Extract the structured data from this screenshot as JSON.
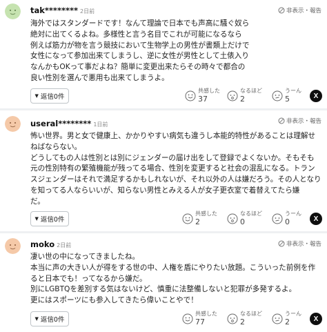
{
  "report_label": "非表示・報告",
  "comments": [
    {
      "username": "tak********",
      "date": "2日前",
      "avatar_color": "#c6e3b0",
      "lines": [
        "海外ではスタンダードです！なんて理論で日本でも声高に騒ぐ奴ら",
        "絶対に出てくるよね。多様性と言う名目でこれが可能になるなら",
        "例えば筋力が物を言う競技において生物学上の男性が書類上だけで",
        "女性になって参加出来てしまうし、逆に女性が男性として土俵入り",
        "なんかもOKって事だよね？簡単に変更出来たらその時々で都合の",
        "良い性別を選んで悪用も出来てしまうよ。"
      ],
      "reply_label": "返信",
      "reply_count": "0件",
      "reactions": [
        {
          "label": "共感した",
          "count": "37"
        },
        {
          "label": "なるほど",
          "count": "2"
        },
        {
          "label": "うーん",
          "count": "5"
        }
      ]
    },
    {
      "username": "useral********",
      "date": "1日前",
      "avatar_color": "#f5c9a8",
      "lines": [
        "怖い世界。男と女で健康上、かかりやすい病気も違うし本能的特性があることは理解せ",
        "ねばならない。",
        "どうしてもの人は性別とは別にジェンダーの届け出をして登録でよくないか。そもそも",
        "元の性別特有の繁殖機能が残ってる場合、性別を変更すると社会の混乱になる。トラン",
        "スジェンダーはそれで満足するかもしれないが、それ以外の人は嫌だろう。その人となり",
        "を知ってる人ならいいが、知らない男性とみえる人が女子更衣室で着替えてたら嫌",
        "だ。"
      ],
      "reply_label": "返信",
      "reply_count": "0件",
      "reactions": [
        {
          "label": "共感した",
          "count": "2"
        },
        {
          "label": "なるほど",
          "count": "0"
        },
        {
          "label": "うーん",
          "count": "0"
        }
      ]
    },
    {
      "username": "moko",
      "date": "2日前",
      "avatar_color": "#f5c9a8",
      "lines": [
        "凄い世の中になってきましたね。",
        "本当に声の大きい人が得をする世の中、人権を盾にやりたい放題。こういった前例を作",
        "ると日本でも！ってなるから嫌だ。",
        "別にLGBTQを差別する気はないけど、慎重に法整備しないと犯罪が多発するよ。",
        "更にはスポーツにも参入してきたら偉いことやで！"
      ],
      "reply_label": "返信",
      "reply_count": "0件",
      "reactions": [
        {
          "label": "共感した",
          "count": "77"
        },
        {
          "label": "なるほど",
          "count": "2"
        },
        {
          "label": "うーん",
          "count": "2"
        }
      ]
    }
  ],
  "x_icon_glyph": "X"
}
